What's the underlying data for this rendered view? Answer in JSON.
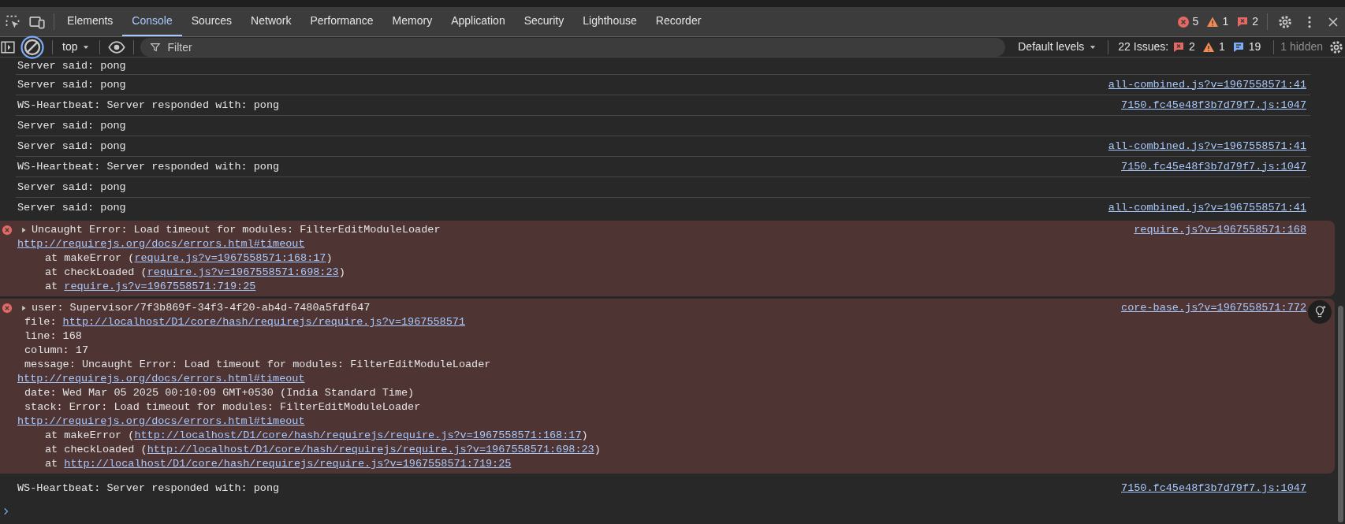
{
  "tabs": [
    {
      "label": "Elements",
      "selected": false
    },
    {
      "label": "Console",
      "selected": true
    },
    {
      "label": "Sources",
      "selected": false
    },
    {
      "label": "Network",
      "selected": false
    },
    {
      "label": "Performance",
      "selected": false
    },
    {
      "label": "Memory",
      "selected": false
    },
    {
      "label": "Application",
      "selected": false
    },
    {
      "label": "Security",
      "selected": false
    },
    {
      "label": "Lighthouse",
      "selected": false
    },
    {
      "label": "Recorder",
      "selected": false
    }
  ],
  "counters": [
    {
      "kind": "error",
      "count": "5"
    },
    {
      "kind": "warning",
      "count": "1"
    },
    {
      "kind": "issue",
      "count": "2"
    }
  ],
  "toolbar": {
    "context": "top",
    "filter": {
      "placeholder": "Filter"
    },
    "levels": "Default levels",
    "issues_label": "22 Issues:",
    "issues": [
      {
        "kind": "issue",
        "count": "2"
      },
      {
        "kind": "warning",
        "count": "1"
      },
      {
        "kind": "info",
        "count": "19"
      }
    ],
    "hidden": "1 hidden"
  },
  "messages": [
    {
      "kind": "log",
      "text": "Server said: pong"
    },
    {
      "kind": "log",
      "text": "Server said: pong",
      "source": "all-combined.js?v=1967558571:41"
    },
    {
      "kind": "log",
      "text": "WS-Heartbeat: Server responded with: pong",
      "source": "7150.fc45e48f3b7d79f7.js:1047"
    },
    {
      "kind": "log",
      "text": "Server said: pong"
    },
    {
      "kind": "log",
      "text": "Server said: pong",
      "source": "all-combined.js?v=1967558571:41"
    },
    {
      "kind": "log",
      "text": "WS-Heartbeat: Server responded with: pong",
      "source": "7150.fc45e48f3b7d79f7.js:1047"
    },
    {
      "kind": "log",
      "text": "Server said: pong"
    },
    {
      "kind": "log",
      "text": "Server said: pong",
      "source": "all-combined.js?v=1967558571:41"
    },
    {
      "kind": "error",
      "expanded": false,
      "insights": false,
      "source": "require.js?v=1967558571:168",
      "lines": [
        {
          "kind": "head",
          "parts": [
            {
              "kind": "text",
              "text": "Uncaught Error: Load timeout for modules: FilterEditModuleLoader"
            }
          ]
        },
        {
          "kind": "plain",
          "parts": [
            {
              "kind": "link",
              "text": "http://requirejs.org/docs/errors.html#timeout"
            }
          ]
        },
        {
          "kind": "frame",
          "parts": [
            {
              "kind": "text",
              "text": "at makeError ("
            },
            {
              "kind": "link",
              "text": "require.js?v=1967558571:168:17"
            },
            {
              "kind": "text",
              "text": ")"
            }
          ]
        },
        {
          "kind": "frame",
          "parts": [
            {
              "kind": "text",
              "text": "at checkLoaded ("
            },
            {
              "kind": "link",
              "text": "require.js?v=1967558571:698:23"
            },
            {
              "kind": "text",
              "text": ")"
            }
          ]
        },
        {
          "kind": "frame",
          "parts": [
            {
              "kind": "text",
              "text": "at "
            },
            {
              "kind": "link",
              "text": "require.js?v=1967558571:719:25"
            }
          ]
        }
      ]
    },
    {
      "kind": "error",
      "expanded": false,
      "insights": true,
      "source": "core-base.js?v=1967558571:772",
      "lines": [
        {
          "kind": "head",
          "parts": [
            {
              "kind": "text",
              "text": "user: Supervisor/7f3b869f-34f3-4f20-ab4d-7480a5fdf647"
            }
          ]
        },
        {
          "kind": "property",
          "parts": [
            {
              "kind": "text",
              "text": "file: "
            },
            {
              "kind": "link",
              "text": "http://localhost/D1/core/hash/requirejs/require.js?v=1967558571"
            }
          ]
        },
        {
          "kind": "property",
          "parts": [
            {
              "kind": "text",
              "text": "line: 168"
            }
          ]
        },
        {
          "kind": "property",
          "parts": [
            {
              "kind": "text",
              "text": "column: 17"
            }
          ]
        },
        {
          "kind": "property",
          "parts": [
            {
              "kind": "text",
              "text": "message: Uncaught Error: Load timeout for modules: FilterEditModuleLoader"
            }
          ]
        },
        {
          "kind": "plain",
          "parts": [
            {
              "kind": "link",
              "text": "http://requirejs.org/docs/errors.html#timeout"
            }
          ]
        },
        {
          "kind": "property",
          "parts": [
            {
              "kind": "text",
              "text": "date: Wed Mar 05 2025 00:10:09 GMT+0530 (India Standard Time)"
            }
          ]
        },
        {
          "kind": "property",
          "parts": [
            {
              "kind": "text",
              "text": "stack: Error: Load timeout for modules: FilterEditModuleLoader"
            }
          ]
        },
        {
          "kind": "plain",
          "parts": [
            {
              "kind": "link",
              "text": "http://requirejs.org/docs/errors.html#timeout"
            }
          ]
        },
        {
          "kind": "frame",
          "parts": [
            {
              "kind": "text",
              "text": "at makeError ("
            },
            {
              "kind": "link",
              "text": "http://localhost/D1/core/hash/requirejs/require.js?v=1967558571:168:17"
            },
            {
              "kind": "text",
              "text": ")"
            }
          ]
        },
        {
          "kind": "frame",
          "parts": [
            {
              "kind": "text",
              "text": "at checkLoaded ("
            },
            {
              "kind": "link",
              "text": "http://localhost/D1/core/hash/requirejs/require.js?v=1967558571:698:23"
            },
            {
              "kind": "text",
              "text": ")"
            }
          ]
        },
        {
          "kind": "frame",
          "parts": [
            {
              "kind": "text",
              "text": "at "
            },
            {
              "kind": "link",
              "text": "http://localhost/D1/core/hash/requirejs/require.js?v=1967558571:719:25"
            }
          ]
        }
      ]
    },
    {
      "kind": "log",
      "text": "WS-Heartbeat: Server responded with: pong",
      "source": "7150.fc45e48f3b7d79f7.js:1047"
    }
  ]
}
